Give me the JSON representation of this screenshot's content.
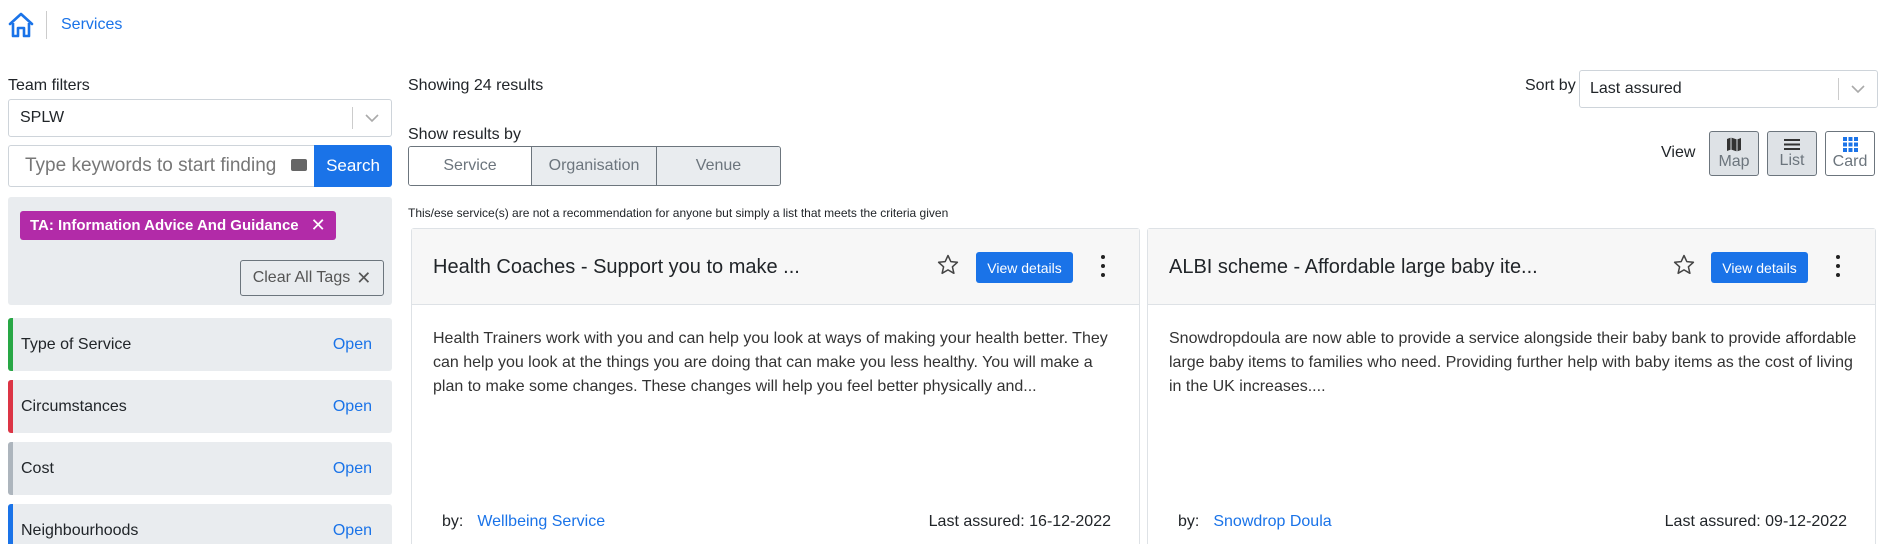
{
  "breadcrumb": {
    "current": "Services"
  },
  "filters": {
    "team_label": "Team filters",
    "team_value": "SPLW",
    "search_placeholder": "Type keywords to start finding",
    "search_button": "Search",
    "active_tag": "TA: Information Advice And Guidance",
    "clear_tags": "Clear All Tags",
    "groups": [
      {
        "name": "Type of Service",
        "action": "Open",
        "color": "#28a745"
      },
      {
        "name": "Circumstances",
        "action": "Open",
        "color": "#dc3545"
      },
      {
        "name": "Cost",
        "action": "Open",
        "color": "#adb5bd"
      },
      {
        "name": "Neighbourhoods",
        "action": "Open",
        "color": "#1a73e8"
      }
    ]
  },
  "results": {
    "showing": "Showing 24 results",
    "show_by_label": "Show results by",
    "show_by": [
      "Service",
      "Organisation",
      "Venue"
    ],
    "sort_label": "Sort by",
    "sort_value": "Last assured",
    "view_label": "View",
    "views": [
      "Map",
      "List",
      "Card"
    ],
    "disclaimer": "This/ese service(s) are not a recommendation for anyone but simply a list that meets the criteria given"
  },
  "cards": [
    {
      "title": "Health Coaches - Support you to make ...",
      "details_button": "View details",
      "description": "Health Trainers work with you and can help you look at ways of making your health better. They can help you look at the things you are doing that can make you less healthy. You will make a plan to make some changes. These changes will help you feel better physically and...",
      "by_label": "by:",
      "organisation": "Wellbeing Service",
      "last_assured": "Last assured: 16-12-2022"
    },
    {
      "title": "ALBI scheme - Affordable large baby ite...",
      "details_button": "View details",
      "description": "Snowdropdoula are now able to provide a service alongside their baby bank to provide affordable large baby items to families who need. Providing further help with baby items as the cost of living in the UK increases....",
      "by_label": "by:",
      "organisation": "Snowdrop Doula",
      "last_assured": "Last assured: 09-12-2022"
    }
  ],
  "colors": {
    "accent": "#1a73e8",
    "tag": "#b22ba8"
  }
}
